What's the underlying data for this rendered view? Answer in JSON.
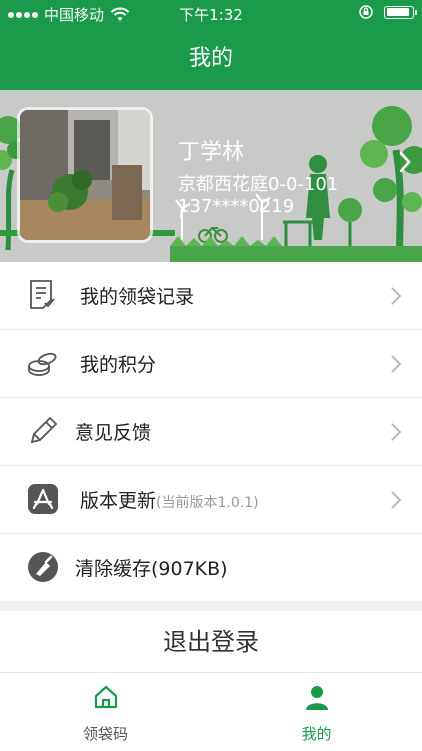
{
  "status_bar": {
    "carrier": "中国移动",
    "time": "下午1:32"
  },
  "nav": {
    "title": "我的"
  },
  "profile": {
    "name": "丁学林",
    "address": "京都西花庭0-0-101",
    "phone": "137****0219"
  },
  "menu": {
    "items": [
      {
        "label": "我的领袋记录",
        "icon": "document-check-icon"
      },
      {
        "label": "我的积分",
        "icon": "coins-icon"
      },
      {
        "label": "意见反馈",
        "icon": "pencil-icon"
      },
      {
        "label": "版本更新",
        "sub": "(当前版本1.0.1)",
        "icon": "app-store-icon"
      },
      {
        "label": "清除缓存(907KB)",
        "icon": "broom-icon"
      }
    ]
  },
  "logout_label": "退出登录",
  "tabbar": {
    "tabs": [
      {
        "label": "领袋码",
        "icon": "home-icon",
        "active": false
      },
      {
        "label": "我的",
        "icon": "user-icon",
        "active": true
      }
    ]
  },
  "colors": {
    "brand": "#1a9a4a",
    "text": "#222222",
    "muted": "#999999"
  }
}
